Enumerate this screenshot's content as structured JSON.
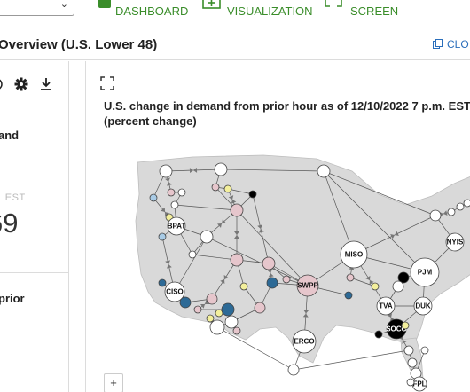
{
  "toolbar": {
    "dashboard_label": "DASHBOARD",
    "visualization_label": "VISUALIZATION",
    "screen_label": "SCREEN",
    "accent_color": "#3a8d2a"
  },
  "header": {
    "title": "Overview (U.S. Lower 48)",
    "right_link": "CLO",
    "link_color": "#2a6ebb"
  },
  "left_panel": {
    "line1": "and",
    "est_label": "L EST",
    "value": "69",
    "line2": "prior"
  },
  "main": {
    "chart_title": "U.S. change in demand from prior hour as of 12/10/2022 7 p.m. EST",
    "chart_subtitle": "(percent change)",
    "zoom_in_label": "+"
  },
  "map": {
    "colors": {
      "white": "#ffffff",
      "pink": "#e6c6cc",
      "yellow": "#f3ef9c",
      "blue_dark": "#2d6a96",
      "blue_light": "#a8cbe6",
      "black": "#000000",
      "land": "#d6d6d6",
      "edge": "#555555"
    },
    "labels": [
      "BPAT",
      "CISO",
      "SWPP",
      "MISO",
      "PJM",
      "NYIS",
      "ERCO",
      "TVA",
      "DUK",
      "SOCO",
      "FPL"
    ]
  }
}
